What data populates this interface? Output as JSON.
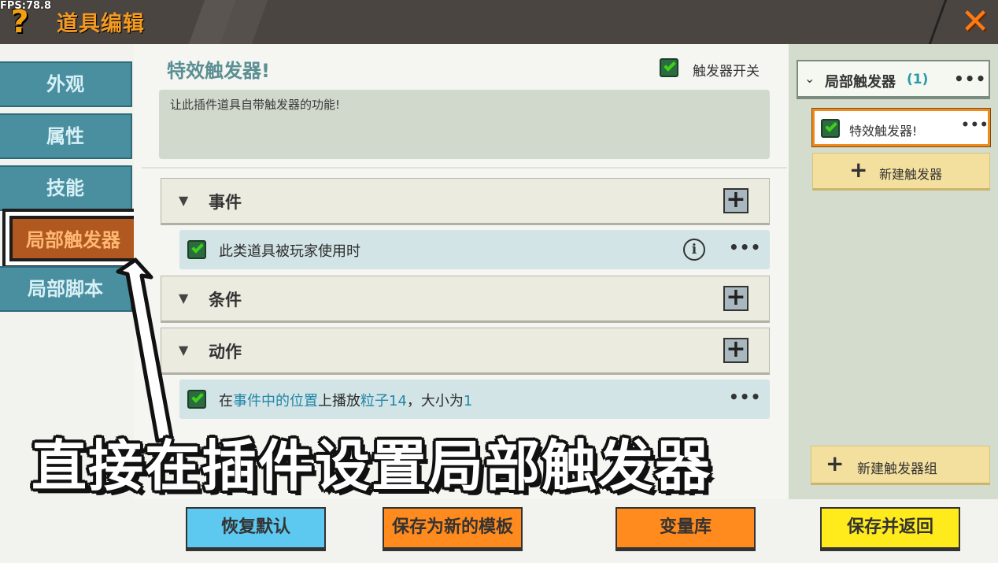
{
  "hud": {
    "fps": "FPS:78.8"
  },
  "header": {
    "title": "道具编辑",
    "help_glyph": "?",
    "close_glyph": "✕"
  },
  "tabs": [
    {
      "label": "外观",
      "active": false
    },
    {
      "label": "属性",
      "active": false
    },
    {
      "label": "技能",
      "active": false
    },
    {
      "label": "局部触发器",
      "active": true
    },
    {
      "label": "局部脚本",
      "active": false
    }
  ],
  "trigger": {
    "title": "特效触发器!",
    "switch_label": "触发器开关",
    "switch_on": true,
    "description": "让此插件道具自带触发器的功能!"
  },
  "sections": {
    "event": {
      "label": "事件"
    },
    "condition": {
      "label": "条件"
    },
    "action": {
      "label": "动作"
    }
  },
  "rows": {
    "event_row": {
      "text": "此类道具被玩家使用时",
      "checked": true
    },
    "action_row": {
      "prefix": "在",
      "pos": "事件中的位置",
      "mid": "上播放",
      "particle": "粒子14",
      "sep": "，大小为",
      "size": "1",
      "checked": true
    }
  },
  "right_panel": {
    "group_name": "局部触发器",
    "group_count": "(1)",
    "item_name": "特效触发器!",
    "new_trigger_label": "新建触发器",
    "new_group_label": "新建触发器组"
  },
  "footer": {
    "restore_default": "恢复默认",
    "save_template": "保存为新的模板",
    "variable_library": "变量库",
    "save_return": "保存并返回"
  },
  "caption": "直接在插件设置局部触发器",
  "colors": {
    "header_bg": "#4a4540",
    "accent_orange": "#f39a22",
    "tab_blue": "#4a8fa0",
    "active_tab": "#b0581f",
    "check_green": "#3ed11c"
  }
}
